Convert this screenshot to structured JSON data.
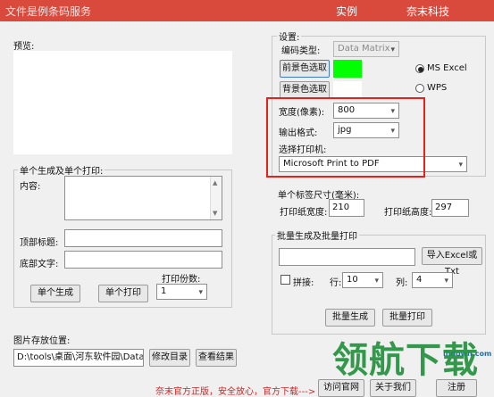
{
  "titlebar": {
    "left_text": "文件是例条码服务",
    "menu1": "实例",
    "menu2": "奈末科技"
  },
  "preview": {
    "label": "预览:"
  },
  "settings": {
    "group_label": "设置:",
    "encode_type_label": "编码类型:",
    "encode_type_value": "Data Matrix",
    "fg_color_button": "前景色选取",
    "bg_color_button": "背景色选取",
    "fg_color": "#00ff00",
    "bg_color": "#ffffff",
    "radio_ms_excel": "MS  Excel",
    "radio_wps": "WPS",
    "width_label": "宽度(像素):",
    "width_value": "800",
    "format_label": "输出格式:",
    "format_value": "jpg",
    "printer_label": "选择打印机:",
    "printer_value": "Microsoft Print to PDF"
  },
  "label_size": {
    "title": "单个标签尺寸(毫米):",
    "paper_width_label": "打印纸宽度:",
    "paper_width_value": "210",
    "paper_height_label": "打印纸高度:",
    "paper_height_value": "297"
  },
  "single": {
    "group_label": "单个生成及单个打印:",
    "content_label": "内容:",
    "top_title_label": "顶部标题:",
    "bottom_text_label": "底部文字:",
    "copies_label": "打印份数:",
    "copies_value": "1",
    "generate_button": "单个生成",
    "print_button": "单个打印"
  },
  "batch": {
    "group_label": "批量生成及批量打印",
    "import_button": "导入Excel或Txt",
    "arrange_label": "拼接:",
    "rows_label": "行:",
    "rows_value": "10",
    "cols_label": "列:",
    "cols_value": "4",
    "generate_button": "批量生成",
    "print_button": "批量打印"
  },
  "storage": {
    "label": "图片存放位置:",
    "path_value": "D:\\tools\\桌面\\河东软件园\\DataMa",
    "modify_button": "修改目录",
    "view_button": "查看结果"
  },
  "footer": {
    "notice": "奈末官方正版，安全放心，官方下载--->",
    "visit_button": "访问官网",
    "about_button": "关于我们",
    "register_button": "注册"
  },
  "watermark": {
    "domain": "lhdown.com",
    "brand": "领航下载"
  },
  "colors": {
    "titlebar": "#d9493c",
    "highlight": "#e8201a",
    "notice": "#c62828"
  }
}
